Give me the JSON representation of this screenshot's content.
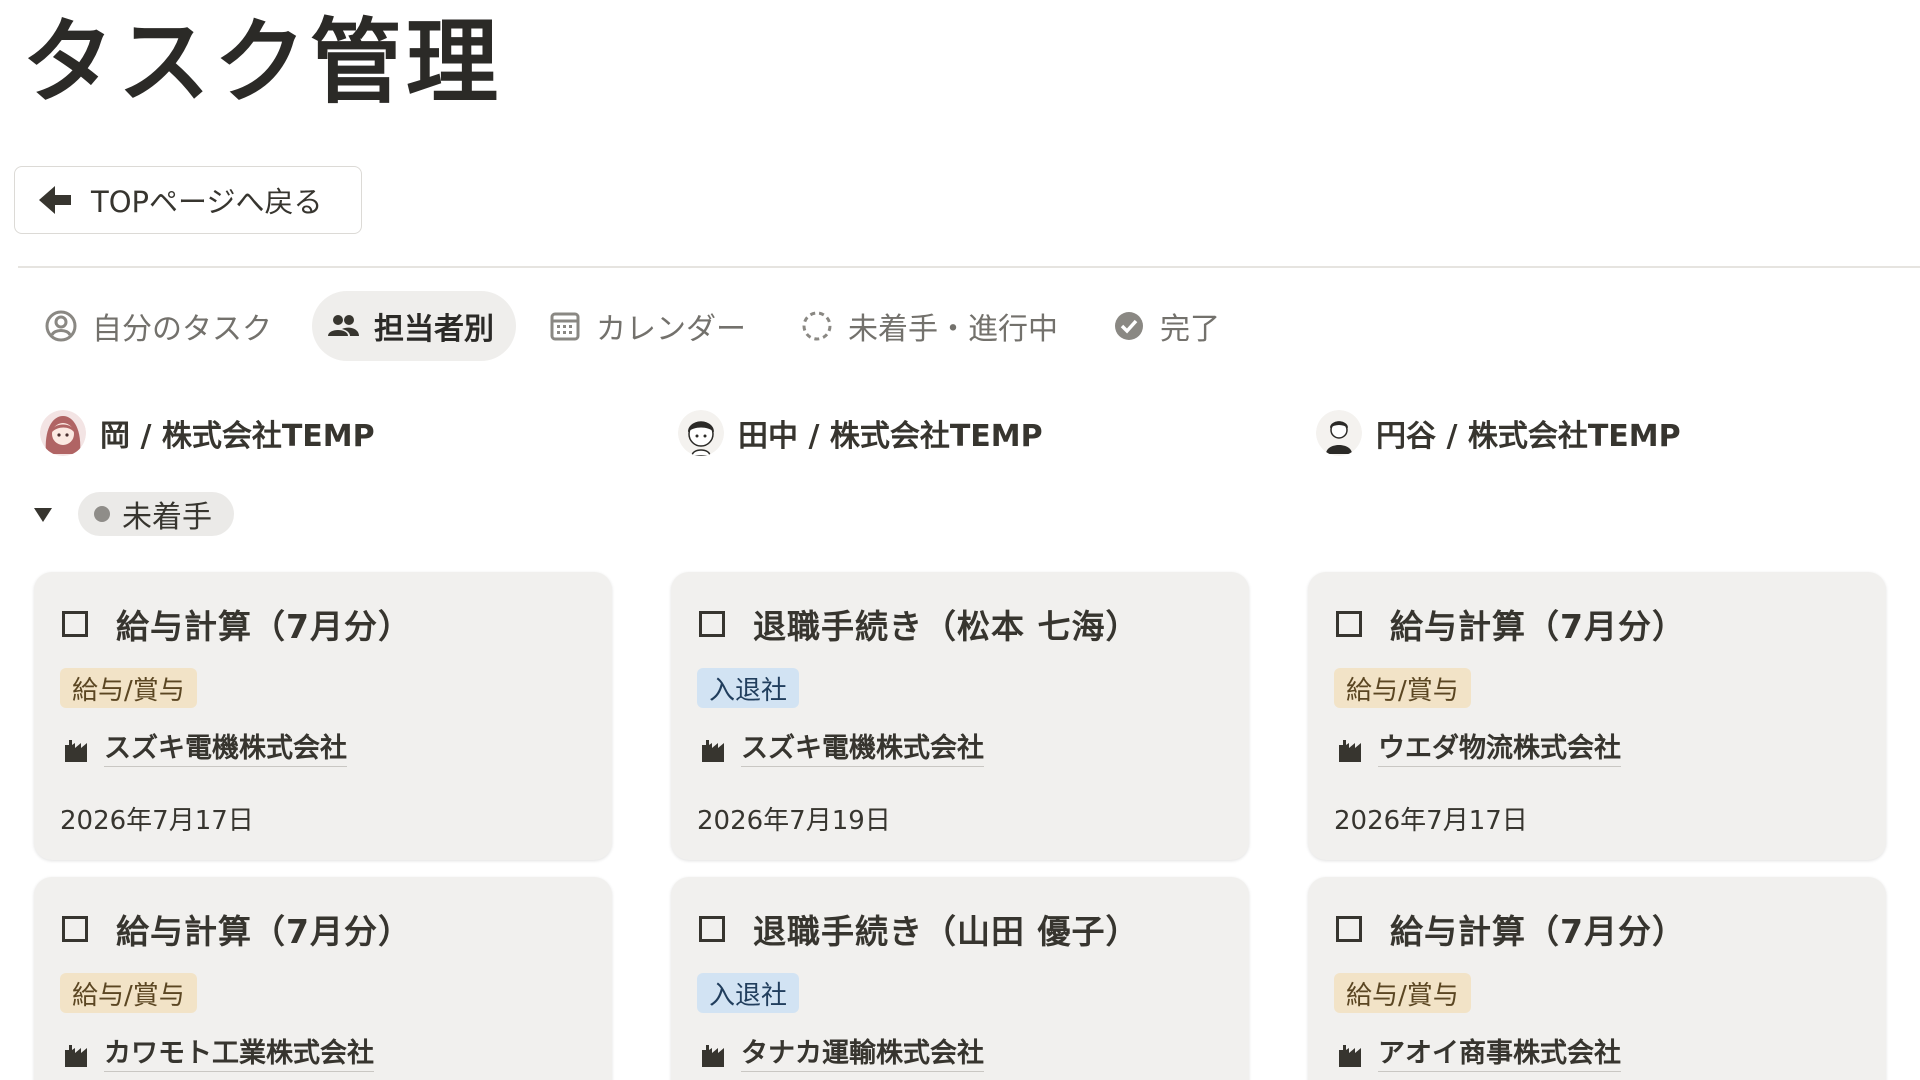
{
  "page": {
    "title": "タスク管理"
  },
  "back_button": {
    "label": "TOPページへ戻る",
    "icon": "arrow-left-icon"
  },
  "tabs": [
    {
      "label": "自分のタスク",
      "icon": "user-circle-icon",
      "active": false
    },
    {
      "label": "担当者別",
      "icon": "people-icon",
      "active": true
    },
    {
      "label": "カレンダー",
      "icon": "calendar-icon",
      "active": false
    },
    {
      "label": "未着手・進行中",
      "icon": "dashed-circle-icon",
      "active": false
    },
    {
      "label": "完了",
      "icon": "check-circle-icon",
      "active": false
    }
  ],
  "assignees": [
    {
      "name": "岡 / 株式会社TEMP",
      "avatar": "avatar-oka"
    },
    {
      "name": "田中 / 株式会社TEMP",
      "avatar": "avatar-tanaka"
    },
    {
      "name": "円谷 / 株式会社TEMP",
      "avatar": "avatar-tsuburaya"
    }
  ],
  "group": {
    "status": "未着手",
    "expanded": true
  },
  "columns": [
    {
      "cards": [
        {
          "title": "給与計算（7月分）",
          "tag": "給与/賞与",
          "tag_color": "#f2e3c7",
          "company": "スズキ電機株式会社",
          "date": "2026年7月17日"
        },
        {
          "title": "給与計算（7月分）",
          "tag": "給与/賞与",
          "tag_color": "#f2e3c7",
          "company": "カワモト工業株式会社",
          "date": ""
        }
      ]
    },
    {
      "cards": [
        {
          "title": "退職手続き（松本 七海）",
          "tag": "入退社",
          "tag_color": "#d2e3f3",
          "company": "スズキ電機株式会社",
          "date": "2026年7月19日"
        },
        {
          "title": "退職手続き（山田 優子）",
          "tag": "入退社",
          "tag_color": "#d2e3f3",
          "company": "タナカ運輸株式会社",
          "date": ""
        }
      ]
    },
    {
      "cards": [
        {
          "title": "給与計算（7月分）",
          "tag": "給与/賞与",
          "tag_color": "#f2e3c7",
          "company": "ウエダ物流株式会社",
          "date": "2026年7月17日"
        },
        {
          "title": "給与計算（7月分）",
          "tag": "給与/賞与",
          "tag_color": "#f2e3c7",
          "company": "アオイ商事株式会社",
          "date": ""
        }
      ]
    }
  ]
}
